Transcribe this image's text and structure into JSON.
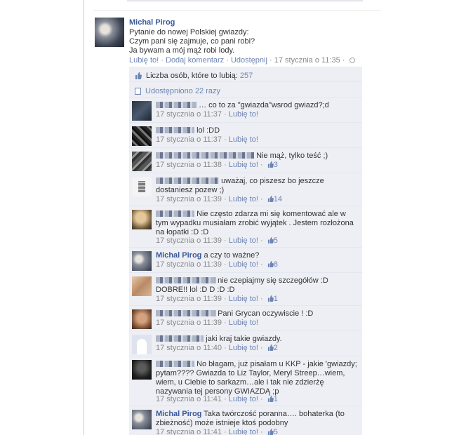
{
  "post": {
    "author": "Michal Pirog",
    "message": [
      "Pytanie do nowej Polskiej gwiazdy:",
      "Czym pani się zajmuje, co pani robi?",
      "Ja bywam a mój mąż robi lody."
    ],
    "actions": {
      "like": "Lubię to!",
      "comment": "Dodaj komentarz",
      "share": "Udostępnij",
      "timestamp": "17 stycznia o 11:35"
    }
  },
  "ufi": {
    "likes_label": "Liczba osób, które to lubią:",
    "likes_count": "257",
    "shares_label": "Udostępniono 22 razy"
  },
  "comments": [
    {
      "author": "",
      "text": "… co to za \"gwiazda\"wsrod gwiazd?;d",
      "time": "17 stycznia o 11:37",
      "like": "Lubię to!",
      "likes": ""
    },
    {
      "author": "",
      "text": "lol :DD",
      "time": "17 stycznia o 11:37",
      "like": "Lubię to!",
      "likes": ""
    },
    {
      "author": "",
      "text": "Nie mąż, tylko teść ;)",
      "time": "17 stycznia o 11:38",
      "like": "Lubię to!",
      "likes": "3"
    },
    {
      "author": "",
      "text": "uważaj, co piszesz bo jeszcze dostaniesz pozew ;)",
      "time": "17 stycznia o 11:39",
      "like": "Lubię to!",
      "likes": "14"
    },
    {
      "author": "",
      "text": "Nie często zdarza mi się komentować ale w tym wypadku musiałam zrobić wyjątek . Jestem rozłożona na łopatki :D :D",
      "time": "17 stycznia o 11:39",
      "like": "Lubię to!",
      "likes": "5"
    },
    {
      "author": "Michal Pirog",
      "text": "a czy to ważne?",
      "time": "17 stycznia o 11:39",
      "like": "Lubię to!",
      "likes": "8"
    },
    {
      "author": "",
      "text": "nie czepiajmy się szczegółów :D DOBRE!! lol :D D :D :D",
      "time": "17 stycznia o 11:39",
      "like": "Lubię to!",
      "likes": "1"
    },
    {
      "author": "",
      "text": "Pani Grycan oczywiscie ! :D",
      "time": "17 stycznia o 11:39",
      "like": "Lubię to!",
      "likes": ""
    },
    {
      "author": "",
      "text": "jaki kraj takie gwiazdy.",
      "time": "17 stycznia o 11:40",
      "like": "Lubię to!",
      "likes": "2"
    },
    {
      "author": "",
      "text": "No błagam, już pisałam u KKP - jakie 'gwiazdy; pytam???? Gwiazda to Liz Taylor, Meryl Streep…wiem, wiem, u Ciebie to sarkazm…ale i tak nie zdzierżę nazywania tej persony GWIAZDĄ ;p",
      "time": "17 stycznia o 11:41",
      "like": "Lubię to!",
      "likes": "1"
    },
    {
      "author": "Michal Pirog",
      "text": "Taka twórczość poranna…. bohaterka (to zbieżność) może istnieje ktoś podobny",
      "time": "17 stycznia o 11:41",
      "like": "Lubię to!",
      "likes": "5"
    }
  ],
  "colors": {
    "link": "#3b5998",
    "link_light": "#6d84b4",
    "ufi_bg": "#edeff4"
  }
}
